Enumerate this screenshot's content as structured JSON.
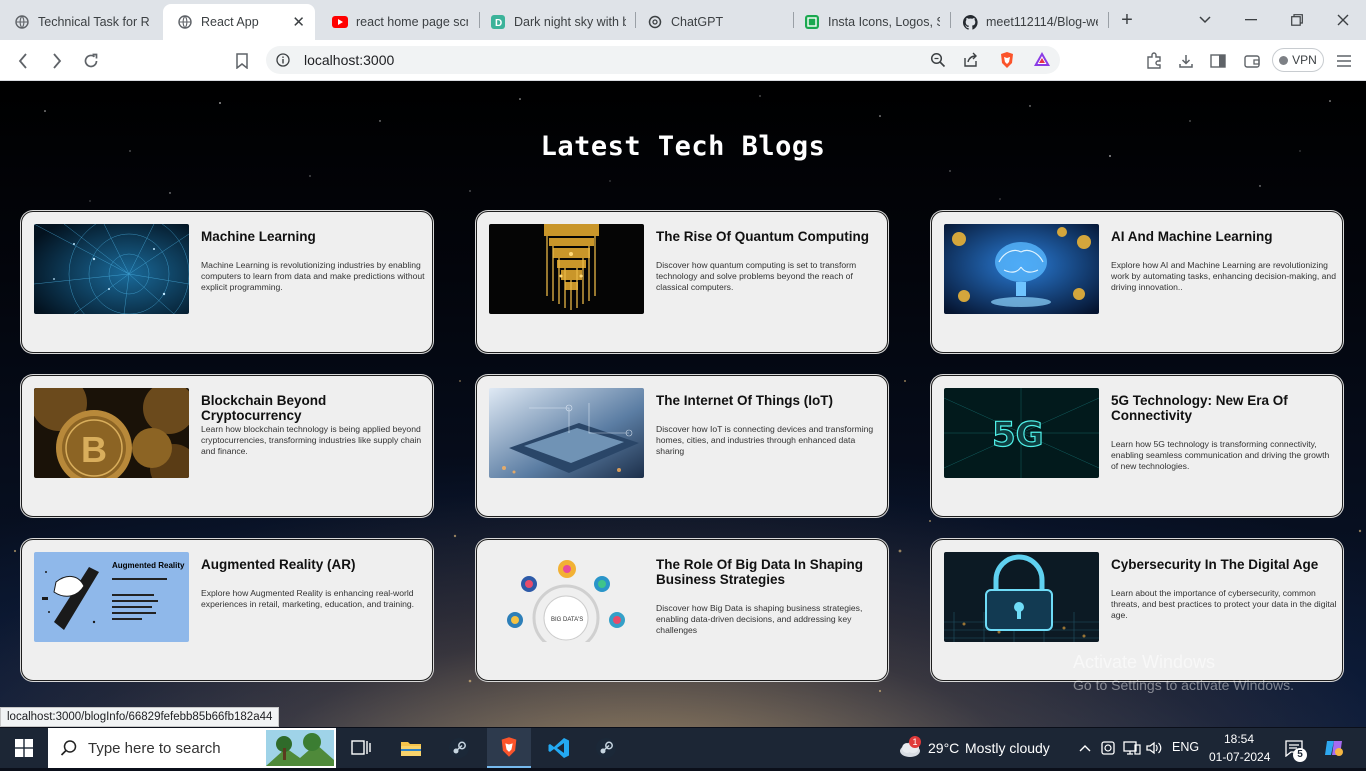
{
  "browser": {
    "tabs": [
      {
        "title": "Technical Task for Rea",
        "icon": "globe-icon",
        "active": false
      },
      {
        "title": "React App",
        "icon": "globe-icon",
        "active": true
      },
      {
        "title": "react home page scrc",
        "icon": "youtube-icon",
        "active": false
      },
      {
        "title": "Dark night sky with b",
        "icon": "d-icon",
        "active": false
      },
      {
        "title": "ChatGPT",
        "icon": "chatgpt-icon",
        "active": false
      },
      {
        "title": "Insta Icons, Logos, Sy",
        "icon": "green-grid-icon",
        "active": false
      },
      {
        "title": "meet112114/Blog-we",
        "icon": "github-icon",
        "active": false
      }
    ],
    "close_glyph": "✕",
    "url": "localhost:3000",
    "vpn_label": "VPN"
  },
  "page": {
    "title": "Latest Tech Blogs",
    "blogs": [
      {
        "title": "Machine Learning",
        "description": "Machine Learning is revolutionizing industries by enabling computers to learn from data and make predictions without explicit programming."
      },
      {
        "title": "The Rise Of Quantum Computing",
        "description": "Discover how quantum computing is set to transform technology and solve problems beyond the reach of classical computers."
      },
      {
        "title": "AI And Machine Learning",
        "description": "Explore how AI and Machine Learning are revolutionizing work by automating tasks, enhancing decision-making, and driving innovation.."
      },
      {
        "title": "Blockchain Beyond Cryptocurrency",
        "description": "Learn how blockchain technology is being applied beyond cryptocurrencies, transforming industries like supply chain and finance."
      },
      {
        "title": "The Internet Of Things (IoT)",
        "description": "Discover how IoT is connecting devices and transforming homes, cities, and industries through enhanced data sharing"
      },
      {
        "title": "5G Technology: New Era Of Connectivity",
        "description": "Learn how 5G technology is transforming connectivity, enabling seamless communication and driving the growth of new technologies."
      },
      {
        "title": "Augmented Reality (AR)",
        "description": "Explore how Augmented Reality is enhancing real-world experiences in retail, marketing, education, and training."
      },
      {
        "title": "The Role Of Big Data In Shaping Business Strategies",
        "description": "Discover how Big Data is shaping business strategies, enabling data-driven decisions, and addressing key challenges"
      },
      {
        "title": "Cybersecurity In The Digital Age",
        "description": "Learn about the importance of cybersecurity, common threats, and best practices to protect your data in the digital age."
      }
    ],
    "thumb_text": {
      "ar_heading": "Augmented Reality",
      "bigdata_center": "BIG DATA'S",
      "fiveg": "5G"
    },
    "status_url": "localhost:3000/blogInfo/66829fefebb85b66fb182a44",
    "watermark_line1": "Activate Windows",
    "watermark_line2": "Go to Settings to activate Windows."
  },
  "taskbar": {
    "search_placeholder": "Type here to search",
    "weather_temp": "29°C",
    "weather_desc": "Mostly cloudy",
    "weather_badge": "1",
    "language": "ENG",
    "time": "18:54",
    "date": "01-07-2024",
    "notification_count": "5"
  },
  "colors": {
    "card_bg": "#efefef",
    "page_title": "#ffffff",
    "taskbar_bg": "#1c2635"
  }
}
